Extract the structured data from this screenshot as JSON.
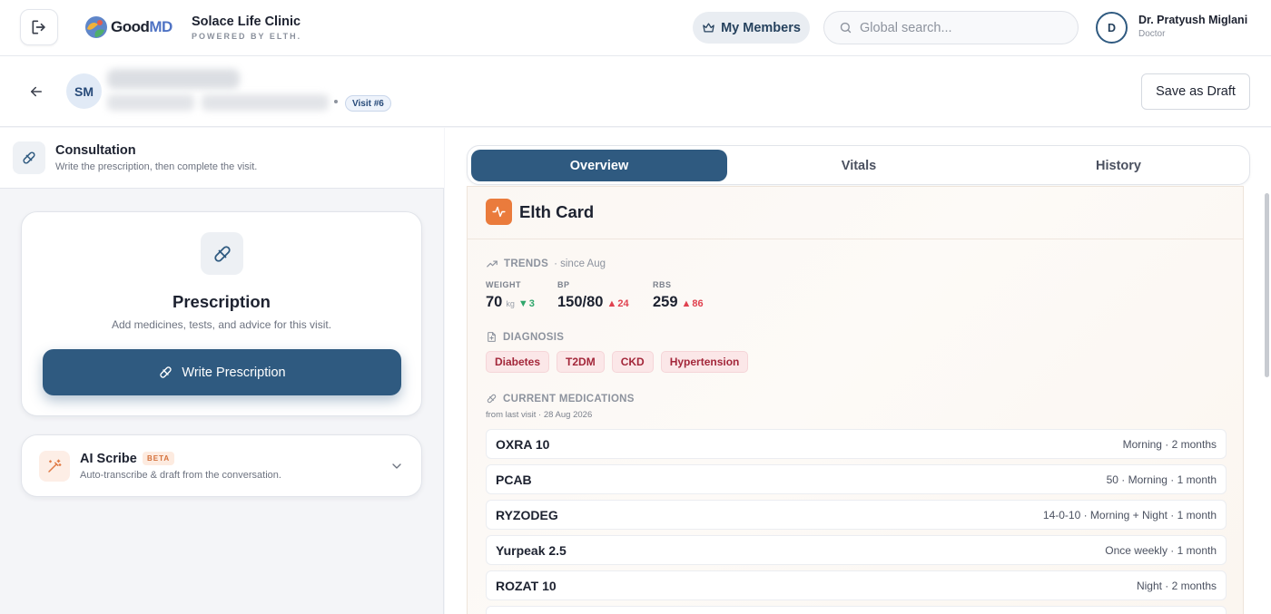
{
  "header": {
    "logo_text_a": "Good",
    "logo_text_b": "MD",
    "clinic_name": "Solace Life Clinic",
    "powered_by": "POWERED BY ELTH.",
    "members_label": "My Members",
    "search_placeholder": "Global search...",
    "user_initial": "D",
    "user_name": "Dr. Pratyush Miglani",
    "user_role": "Doctor"
  },
  "patient": {
    "initials": "SM",
    "visit_badge": "Visit #6",
    "save_draft_label": "Save as Draft"
  },
  "consultation": {
    "title": "Consultation",
    "subtitle": "Write the prescription, then complete the visit."
  },
  "prescription": {
    "title": "Prescription",
    "subtitle": "Add medicines, tests, and advice for this visit.",
    "button_label": "Write Prescription"
  },
  "ai_scribe": {
    "title": "AI Scribe",
    "badge": "BETA",
    "subtitle": "Auto-transcribe & draft from the conversation."
  },
  "tabs": [
    {
      "label": "Overview",
      "active": true
    },
    {
      "label": "Vitals",
      "active": false
    },
    {
      "label": "History",
      "active": false
    }
  ],
  "elth_card": {
    "title": "Elth Card",
    "trends": {
      "label": "TRENDS",
      "since": "· since Aug",
      "metrics": [
        {
          "label": "WEIGHT",
          "value": "70",
          "unit": "kg",
          "delta": "3",
          "direction": "down"
        },
        {
          "label": "BP",
          "value": "150/80",
          "unit": "",
          "delta": "24",
          "direction": "up"
        },
        {
          "label": "RBS",
          "value": "259",
          "unit": "",
          "delta": "86",
          "direction": "up"
        }
      ]
    },
    "diagnosis": {
      "label": "DIAGNOSIS",
      "items": [
        "Diabetes",
        "T2DM",
        "CKD",
        "Hypertension"
      ]
    },
    "medications": {
      "label": "CURRENT MEDICATIONS",
      "meta": "from last visit · 28 Aug 2026",
      "items": [
        {
          "name": "OXRA 10",
          "detail": "Morning · 2 months"
        },
        {
          "name": "PCAB",
          "detail": "50 · Morning · 1 month"
        },
        {
          "name": "RYZODEG",
          "detail": "14-0-10 · Morning + Night · 1 month"
        },
        {
          "name": "Yurpeak 2.5",
          "detail": "Once weekly · 1 month"
        },
        {
          "name": "ROZAT 10",
          "detail": "Night · 2 months"
        }
      ]
    }
  },
  "colors": {
    "primary": "#2f5a80",
    "accent_orange": "#ea7b3c",
    "trend_up": "#e0414f",
    "trend_down": "#2fa66b",
    "diagnosis_chip_text": "#a3273a"
  }
}
